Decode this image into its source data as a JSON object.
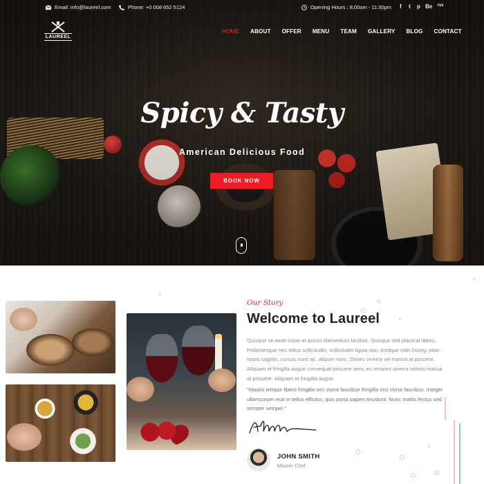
{
  "topbar": {
    "email": "Email: info@laureel.com",
    "phone": "Phone: +0 008 652 5124",
    "hours": "Opening Hours : 8:00am - 11:30pm",
    "social": [
      "f",
      "t",
      "p",
      "Be",
      "rss"
    ]
  },
  "logo": {
    "text": "LAUREEL"
  },
  "nav": {
    "items": [
      "HOME",
      "ABOUT",
      "OFFER",
      "MENU",
      "TEAM",
      "GALLERY",
      "BLOG",
      "CONTACT"
    ],
    "active": "HOME"
  },
  "hero": {
    "title": "Spicy & Tasty",
    "subtitle": "American Delicious Food",
    "cta": "BOOK NOW"
  },
  "about": {
    "label": "Our Story",
    "title": "Welcome to Laureel",
    "paragraph1": "Quisque sit amet turpis et ipsum elementum facilisis. Quisque sed placerat libero. Pellentesque nec tellus sollicitudin, sollicitudin ligula non, tristique nibh Donec vitae turpis sagittis, cursus nunc ac, aliquet nunc. Donec viverra vel massa at posuere. Aliquam et fringilla augue consequat posuere sem, eu ornares viverra veleso massa at posuere. Aliquam et fringilla augue",
    "paragraph2": "\"Mauris tempor libero fringilla orci vivrra faucibue fringilla orci vivrra faucibus. Integer ullamcorper erat in tellus efficitur, quis porta sapien tincidunt. Nunc mattis lectus sed semper semper.\"",
    "chef_name": "JOHN SMITH",
    "chef_role": "Master Chef"
  },
  "colors": {
    "accent": "#ee1b24",
    "hero_bg": "#1c1815",
    "heading": "#222222",
    "body_text": "#8a8a8a"
  }
}
